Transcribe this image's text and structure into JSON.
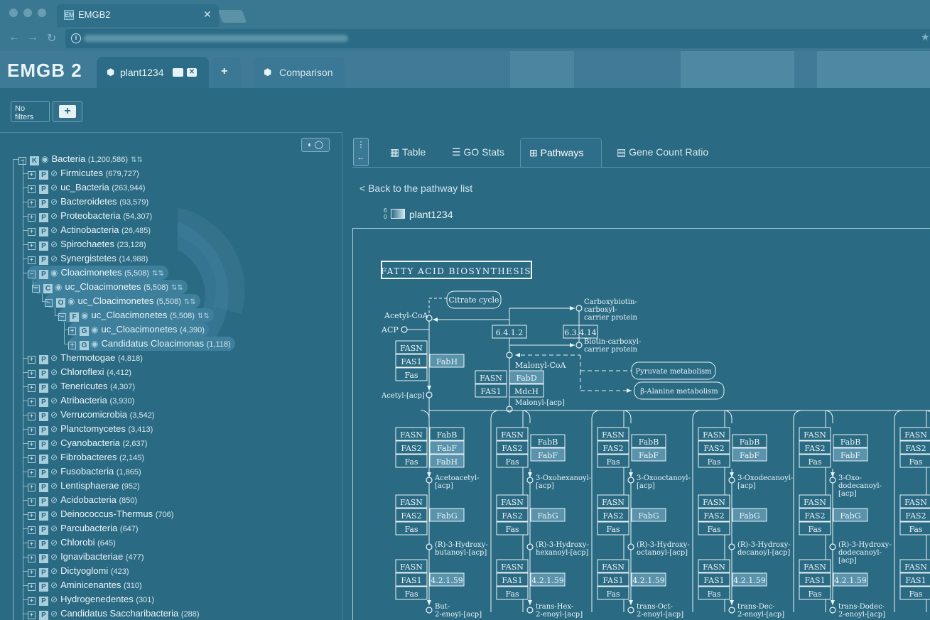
{
  "browser": {
    "tab_title": "EMGB2",
    "favicon": "EM",
    "close": "✕"
  },
  "app": {
    "logo": "EMGB 2",
    "tabs": [
      {
        "label": "plant1234",
        "icon": "cube-icon"
      },
      {
        "label": "+",
        "icon": "plus-icon"
      },
      {
        "label": "Comparison",
        "icon": "cubes-icon"
      }
    ]
  },
  "filters": {
    "status": "No filters",
    "add": "+"
  },
  "tree": {
    "root": {
      "label": "Bacteria",
      "count": "(1,200,586)",
      "rank": "K",
      "exp": "−"
    },
    "phyla_top": [
      {
        "label": "Firmicutes",
        "count": "(679,727)"
      },
      {
        "label": "uc_Bacteria",
        "count": "(263,944)"
      },
      {
        "label": "Bacteroidetes",
        "count": "(93,579)"
      },
      {
        "label": "Proteobacteria",
        "count": "(54,307)"
      },
      {
        "label": "Actinobacteria",
        "count": "(26,485)"
      },
      {
        "label": "Spirochaetes",
        "count": "(23,128)"
      },
      {
        "label": "Synergistetes",
        "count": "(14,988)"
      }
    ],
    "expanded": [
      {
        "label": "Cloacimonetes",
        "count": "(5,508)",
        "rank": "P"
      },
      {
        "label": "uc_Cloacimonetes",
        "count": "(5,508)",
        "rank": "C"
      },
      {
        "label": "uc_Cloacimonetes",
        "count": "(5,508)",
        "rank": "O"
      },
      {
        "label": "uc_Cloacimonetes",
        "count": "(5,508)",
        "rank": "F"
      },
      {
        "label": "uc_Cloacimonetes",
        "count": "(4,390)",
        "rank": "G"
      },
      {
        "label": "Candidatus Cloacimonas",
        "count": "(1,118)",
        "rank": "G"
      }
    ],
    "phyla_bottom": [
      {
        "label": "Thermotogae",
        "count": "(4,818)"
      },
      {
        "label": "Chloroflexi",
        "count": "(4,412)"
      },
      {
        "label": "Tenericutes",
        "count": "(4,307)"
      },
      {
        "label": "Atribacteria",
        "count": "(3,930)"
      },
      {
        "label": "Verrucomicrobia",
        "count": "(3,542)"
      },
      {
        "label": "Planctomycetes",
        "count": "(3,413)"
      },
      {
        "label": "Cyanobacteria",
        "count": "(2,637)"
      },
      {
        "label": "Fibrobacteres",
        "count": "(2,145)"
      },
      {
        "label": "Fusobacteria",
        "count": "(1,865)"
      },
      {
        "label": "Lentisphaerae",
        "count": "(952)"
      },
      {
        "label": "Acidobacteria",
        "count": "(850)"
      },
      {
        "label": "Deinococcus-Thermus",
        "count": "(706)"
      },
      {
        "label": "Parcubacteria",
        "count": "(647)"
      },
      {
        "label": "Chlorobi",
        "count": "(645)"
      },
      {
        "label": "Ignavibacteriae",
        "count": "(477)"
      },
      {
        "label": "Dictyoglomi",
        "count": "(423)"
      },
      {
        "label": "Aminicenantes",
        "count": "(310)"
      },
      {
        "label": "Hydrogenedentes",
        "count": "(301)"
      },
      {
        "label": "Candidatus Saccharibacteria",
        "count": "(288)"
      }
    ]
  },
  "view_tabs": [
    {
      "label": "Table",
      "icon": "table-icon"
    },
    {
      "label": "GO Stats",
      "icon": "list-icon"
    },
    {
      "label": "Pathways",
      "icon": "pathway-icon",
      "active": true
    },
    {
      "label": "Gene Count Ratio",
      "icon": "document-icon"
    }
  ],
  "pathway": {
    "back_link": "< Back to the pathway list",
    "sample": "plant1234",
    "legend_top": "6",
    "legend_bottom": "0",
    "title": "FATTY ACID BIOSYNTHESIS",
    "labels": {
      "citrate": "Citrate cycle",
      "acetylcoa": "Acetyl-CoA",
      "acp": "ACP",
      "carboxybiotin": [
        "Carboxybiotin-",
        "carboxyl-",
        "carrier protein"
      ],
      "biotin": [
        "Biotin-carboxyl-",
        "carrier protein"
      ],
      "ec1": "6.4.1.2",
      "ec2": "6.3.4.14",
      "malonylcoa": "Malonyl-CoA",
      "pyruvate": "Pyruvate metabolism",
      "alanine": "β-Alanine metabolism",
      "acetylacp": "Acetyl-[acp]",
      "malonylacp": "Malonyl-[acp]",
      "fasn": "FASN",
      "fas1": "FAS1",
      "fas2": "FAS2",
      "fas": "Fas",
      "fabh": "FabH",
      "fabd": "FabD",
      "mdch": "MdcH",
      "fabb": "FabB",
      "fabf": "FabF",
      "fabg": "FabG",
      "ec3": "4.2.1.59"
    },
    "columns": [
      {
        "keto": [
          "Acetoacetyl-",
          "[acp]"
        ],
        "hydroxy": [
          "(R)-3-Hydroxy-",
          "butanoyl-[acp]"
        ],
        "enoyl": [
          "But-",
          "2-enoyl-[acp]"
        ]
      },
      {
        "keto": [
          "3-Oxohexanoyl-",
          "[acp]"
        ],
        "hydroxy": [
          "(R)-3-Hydroxy-",
          "hexanoyl-[acp]"
        ],
        "enoyl": [
          "trans-Hex-",
          "2-enoyl-[acp]"
        ]
      },
      {
        "keto": [
          "3-Oxooctanoyl-",
          "[acp]"
        ],
        "hydroxy": [
          "(R)-3-Hydroxy-",
          "octanoyl-[acp]"
        ],
        "enoyl": [
          "trans-Oct-",
          "2-enoyl-[acp]"
        ]
      },
      {
        "keto": [
          "3-Oxodecanoyl-",
          "[acp]"
        ],
        "hydroxy": [
          "(R)-3-Hydroxy-",
          "decanoyl-[acp]"
        ],
        "enoyl": [
          "trans-Dec-",
          "2-enoyl-[acp]"
        ]
      },
      {
        "keto": [
          "3-Oxo-",
          "dodecanoyl-",
          "[acp]"
        ],
        "hydroxy": [
          "(R)-3-Hydroxy-",
          "dodecanoyl-",
          "[acp]"
        ],
        "enoyl": [
          "trans-Dodec-",
          "2-enoyl-[acp]"
        ]
      },
      {
        "keto": [],
        "hydroxy": [],
        "enoyl": []
      }
    ]
  }
}
